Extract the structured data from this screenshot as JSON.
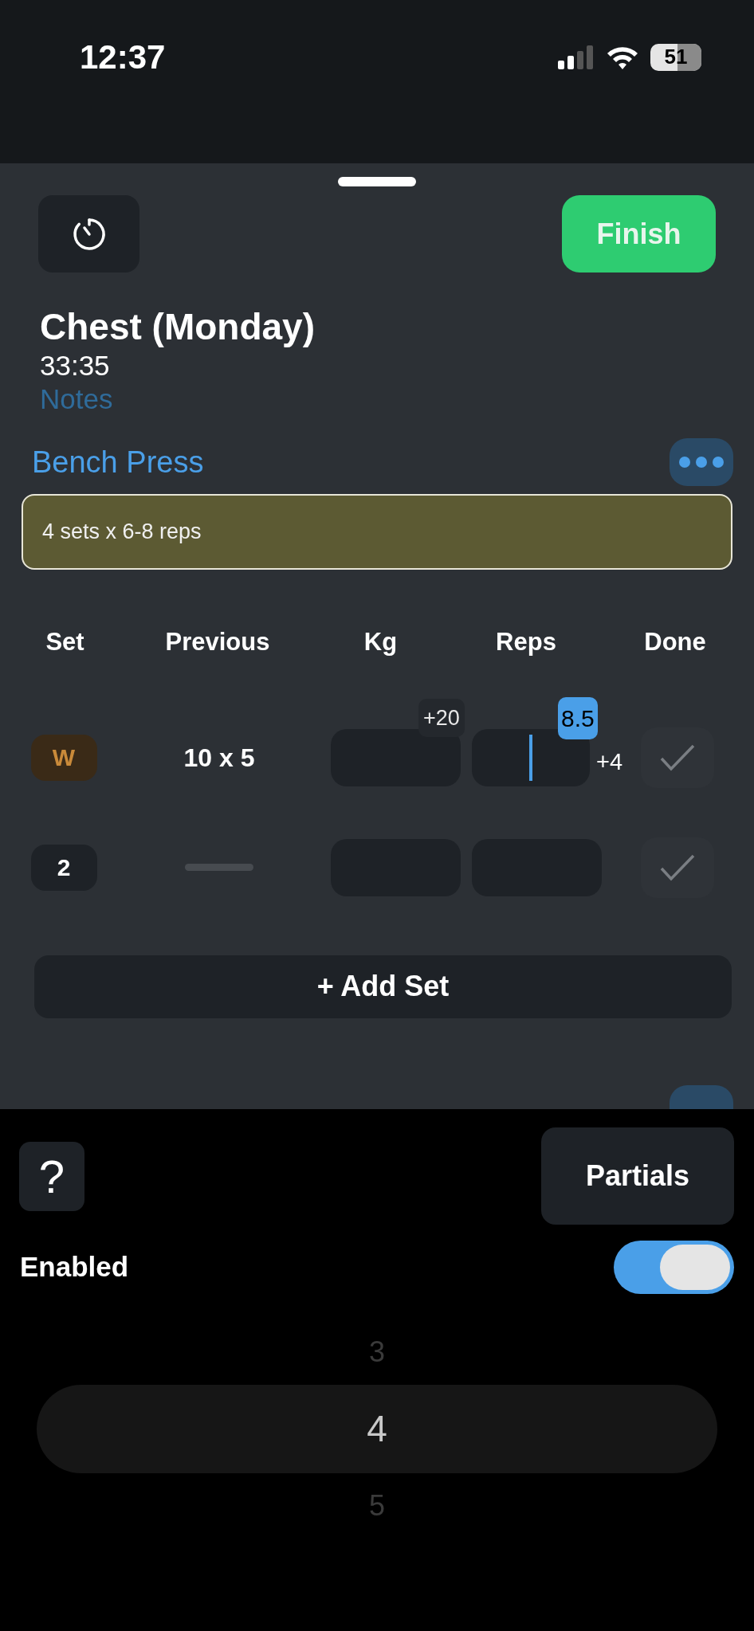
{
  "status_bar": {
    "time": "12:37",
    "battery": "51"
  },
  "header": {
    "finish_button": "Finish"
  },
  "workout": {
    "title": "Chest (Monday)",
    "duration": "33:35",
    "notes_placeholder": "Notes"
  },
  "exercise": {
    "name": "Bench Press",
    "note": "4 sets x 6-8 reps"
  },
  "columns": [
    "Set",
    "Previous",
    "Kg",
    "Reps",
    "Done"
  ],
  "sets": [
    {
      "kind": "warmup",
      "label": "W",
      "previous": "10 x 5",
      "kg_hint": "+20",
      "reps_hint": "8.5",
      "reps_delta": "+4",
      "focused": true,
      "done": false
    },
    {
      "kind": "normal",
      "label": "2",
      "focused": false,
      "done": false
    }
  ],
  "add_set_button": "+ Add Set",
  "partials": {
    "help_button": "?",
    "title": "Partials",
    "enabled_label": "Enabled",
    "enabled": true,
    "picker": [
      {
        "value": "3",
        "selected": false
      },
      {
        "value": "4",
        "selected": true
      },
      {
        "value": "5",
        "selected": false
      }
    ]
  }
}
